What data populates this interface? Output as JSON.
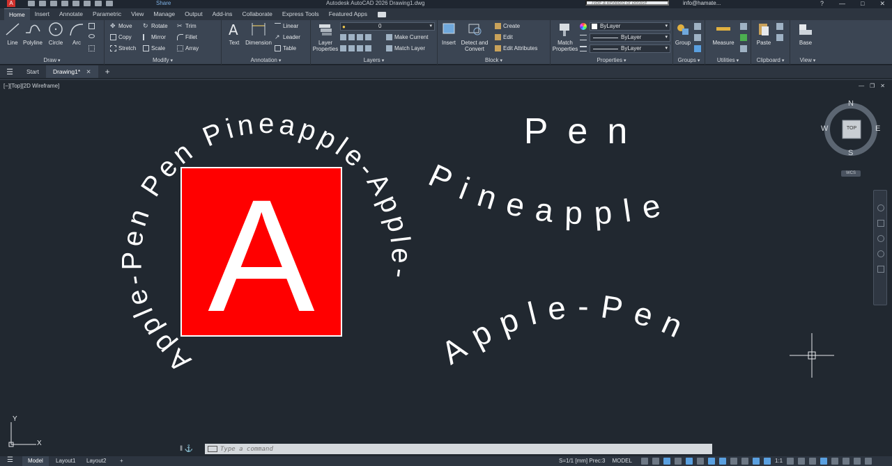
{
  "titlebar": {
    "app_logo": "A",
    "share": "Share",
    "title": "Autodesk AutoCAD 2026    Drawing1.dwg",
    "search_placeholder": "Type a keyword or phrase",
    "user": "info@hamate...",
    "help": "?"
  },
  "ribbon_tabs": [
    "Home",
    "Insert",
    "Annotate",
    "Parametric",
    "View",
    "Manage",
    "Output",
    "Add-ins",
    "Collaborate",
    "Express Tools",
    "Featured Apps"
  ],
  "ribbon": {
    "draw": {
      "title": "Draw",
      "line": "Line",
      "polyline": "Polyline",
      "circle": "Circle",
      "arc": "Arc"
    },
    "modify": {
      "title": "Modify",
      "move": "Move",
      "rotate": "Rotate",
      "trim": "Trim",
      "copy": "Copy",
      "mirror": "Mirror",
      "fillet": "Fillet",
      "stretch": "Stretch",
      "scale": "Scale",
      "array": "Array"
    },
    "annotation": {
      "title": "Annotation",
      "text": "Text",
      "dimension": "Dimension",
      "linear": "Linear",
      "leader": "Leader",
      "table": "Table"
    },
    "layers": {
      "title": "Layers",
      "layer_properties_1": "Layer",
      "layer_properties_2": "Properties",
      "layer_value": "0",
      "make_current": "Make Current",
      "match_layer": "Match Layer"
    },
    "block": {
      "title": "Block",
      "insert": "Insert",
      "detect_1": "Detect and",
      "detect_2": "Convert",
      "create": "Create",
      "edit": "Edit",
      "edit_attributes": "Edit Attributes"
    },
    "properties": {
      "title": "Properties",
      "match_1": "Match",
      "match_2": "Properties",
      "color": "ByLayer",
      "linetype": "ByLayer",
      "lineweight": "ByLayer"
    },
    "groups": {
      "title": "Groups",
      "group": "Group"
    },
    "utilities": {
      "title": "Utilities",
      "measure": "Measure"
    },
    "clipboard": {
      "title": "Clipboard",
      "paste": "Paste"
    },
    "view": {
      "title": "View",
      "base": "Base"
    }
  },
  "file_tabs": {
    "start": "Start",
    "drawing": "Drawing1*"
  },
  "viewport": {
    "label": "[−][Top][2D Wireframe]"
  },
  "viewcube": {
    "n": "N",
    "s": "S",
    "e": "E",
    "w": "W",
    "top": "TOP",
    "wcs": "WCS"
  },
  "drawing": {
    "big_letter": "A",
    "circle_text": "Apple-Pen Pen Pineapple-Apple-",
    "pen_text": "Pen",
    "pineapple_text": "Pineapple",
    "applepen_text": "Apple-Pen",
    "ucs_x": "X",
    "ucs_y": "Y",
    "box_color": "#ff0000",
    "text_color": "#ffffff"
  },
  "cmdline": {
    "placeholder": "Type a command"
  },
  "statusbar": {
    "model": "Model",
    "layout1": "Layout1",
    "layout2": "Layout2",
    "scale": "S=1/1 [mm] Prec:3",
    "space": "MODEL",
    "annoscale": "1:1"
  }
}
